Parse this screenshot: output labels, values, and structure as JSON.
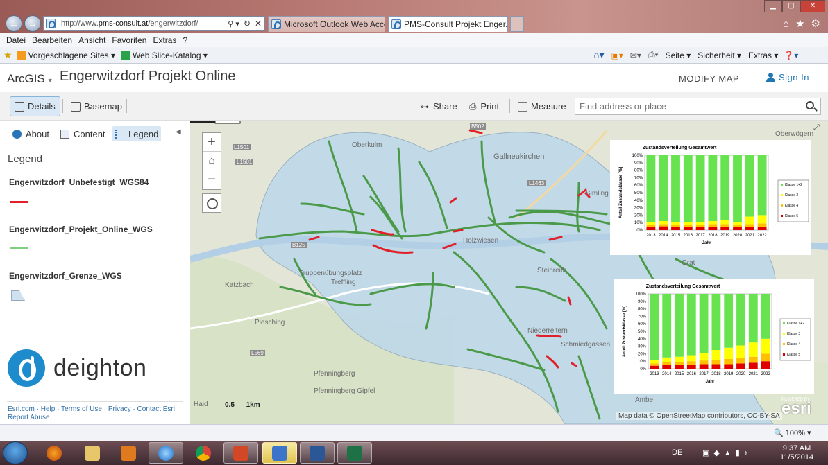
{
  "browser": {
    "url_prefix": "http://www.",
    "url_domain": "pms-consult.at",
    "url_path": "/engerwitzdorf/",
    "tabs": [
      {
        "label": "Microsoft Outlook Web Access"
      },
      {
        "label": "PMS-Consult Projekt Enger..."
      }
    ],
    "menu": [
      "Datei",
      "Bearbeiten",
      "Ansicht",
      "Favoriten",
      "Extras",
      "?"
    ],
    "favorites": [
      {
        "label": "Vorgeschlagene Sites ▾"
      },
      {
        "label": "Web Slice-Katalog ▾"
      }
    ],
    "commands": [
      "Seite ▾",
      "Sicherheit ▾",
      "Extras ▾"
    ],
    "zoom": "100%"
  },
  "app": {
    "brand": "ArcGIS",
    "title": "Engerwitzdorf Projekt Online",
    "modify_map": "MODIFY MAP",
    "sign_in": "Sign In",
    "toolbar": {
      "details": "Details",
      "basemap": "Basemap",
      "share": "Share",
      "print": "Print",
      "measure": "Measure",
      "search_placeholder": "Find address or place"
    }
  },
  "panel": {
    "tabs": [
      "About",
      "Content",
      "Legend"
    ],
    "legend_title": "Legend",
    "layers": [
      {
        "name": "Engerwitzdorf_Unbefestigt_WGS84",
        "color": "#e0202a"
      },
      {
        "name": "Engerwitzdorf_Projekt_Online_WGS",
        "color": "#7fcf7f"
      },
      {
        "name": "Engerwitzdorf_Grenze_WGS",
        "color": "#cde1f0"
      }
    ],
    "logo": "deighton",
    "footer": "Esri.com · Help · Terms of Use · Privacy · Contact Esri · Report Abuse"
  },
  "map": {
    "labels": [
      "Oberkulm",
      "Gallneukirchen",
      "Oberwögern",
      "Simling",
      "Holzwiesen",
      "Steinreith",
      "Katzbach",
      "Treffling",
      "Truppenübungsplatz",
      "Piesching",
      "Niederreitern",
      "Schmiedgassen",
      "Pfenningberg",
      "Pfenningberg Gipfel",
      "Ambe",
      "Grat",
      "Haid"
    ],
    "roads": [
      "L1501",
      "L1501",
      "L1463",
      "B125",
      "B502",
      "L569"
    ],
    "scale_label": "0.5      1km",
    "attribution": "Map data © OpenStreetMap contributors, CC-BY-SA",
    "esri_powered": "POWERED BY",
    "esri": "esri"
  },
  "charts": {
    "colors": {
      "k12": "#66e34f",
      "k3": "#ffff00",
      "k4": "#ffc000",
      "k5": "#e00000"
    },
    "chart_data": [
      {
        "type": "bar",
        "title": "Zustandsverteilung Gesamtwert",
        "xlabel": "Jahr",
        "ylabel": "Anteil Zustandsklasse [%]",
        "ylim": [
          0,
          100
        ],
        "yticks": [
          "0%",
          "10%",
          "20%",
          "30%",
          "40%",
          "50%",
          "60%",
          "70%",
          "80%",
          "90%",
          "100%"
        ],
        "categories": [
          "2013",
          "2014",
          "2015",
          "2016",
          "2017",
          "2018",
          "2019",
          "2020",
          "2021",
          "2022"
        ],
        "legend": [
          "Klasse 1+2",
          "Klasse 3",
          "Klasse 4",
          "Klasse 5"
        ],
        "series": [
          {
            "name": "Klasse 5",
            "values": [
              4,
              5,
              4,
              4,
              4,
              4,
              4,
              4,
              4,
              4
            ]
          },
          {
            "name": "Klasse 4",
            "values": [
              3,
              3,
              3,
              3,
              3,
              4,
              4,
              3,
              4,
              5
            ]
          },
          {
            "name": "Klasse 3",
            "values": [
              4,
              4,
              4,
              4,
              4,
              4,
              5,
              4,
              10,
              11
            ]
          },
          {
            "name": "Klasse 1+2",
            "values": [
              89,
              88,
              89,
              89,
              89,
              88,
              87,
              89,
              82,
              80
            ]
          }
        ]
      },
      {
        "type": "bar",
        "title": "Zustandsverteilung Gesamtwert",
        "xlabel": "Jahr",
        "ylabel": "Anteil Zustandsklasse [%]",
        "ylim": [
          0,
          100
        ],
        "yticks": [
          "0%",
          "10%",
          "20%",
          "30%",
          "40%",
          "50%",
          "60%",
          "70%",
          "80%",
          "90%",
          "100%"
        ],
        "categories": [
          "2013",
          "2014",
          "2015",
          "2016",
          "2017",
          "2018",
          "2019",
          "2020",
          "2021",
          "2022"
        ],
        "legend": [
          "Klasse 1+2",
          "Klasse 3",
          "Klasse 4",
          "Klasse 5"
        ],
        "series": [
          {
            "name": "Klasse 5",
            "values": [
              4,
              5,
              5,
              5,
              6,
              6,
              6,
              7,
              8,
              10
            ]
          },
          {
            "name": "Klasse 4",
            "values": [
              3,
              4,
              4,
              5,
              5,
              6,
              7,
              7,
              8,
              10
            ]
          },
          {
            "name": "Klasse 3",
            "values": [
              5,
              6,
              7,
              8,
              10,
              13,
              15,
              17,
              19,
              20
            ]
          },
          {
            "name": "Klasse 1+2",
            "values": [
              88,
              85,
              84,
              82,
              79,
              75,
              72,
              69,
              65,
              60
            ]
          }
        ]
      }
    ]
  },
  "statusbar": {
    "zoom": "100%"
  },
  "taskbar": {
    "lang": "DE",
    "time": "9:37 AM",
    "date": "11/5/2014"
  }
}
